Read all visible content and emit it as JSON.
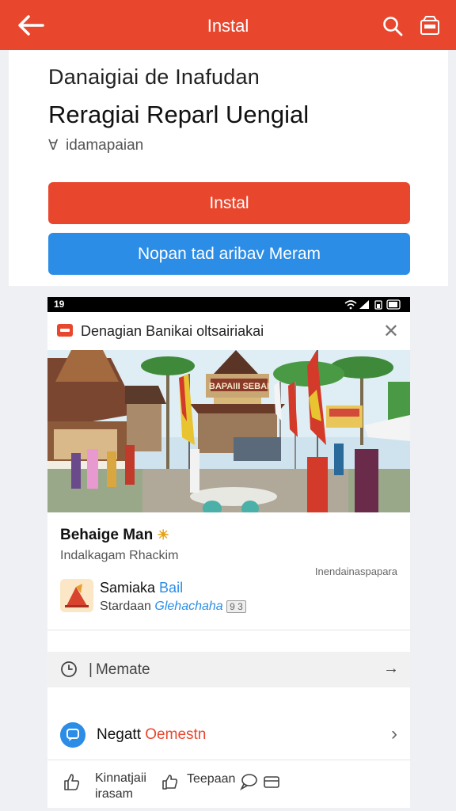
{
  "topbar": {
    "title": "Instal",
    "colors": {
      "background": "#e8472e"
    }
  },
  "header": {
    "app_subtitle": "Danaigiai de Inafudan",
    "app_name": "Reragiai Reparl Uengial",
    "developer": "idamapaian",
    "install_label": "Instal",
    "open_label": "Nopan tad aribav Meram"
  },
  "phone": {
    "status_time": "19",
    "notification": {
      "title": "Denagian Banikai oltsairiakai"
    },
    "post": {
      "title": "Behaige Man",
      "subtitle": "Indalkagam Rhackim",
      "meta": "Inendainaspapara"
    },
    "app_row": {
      "name": "Samiaka",
      "name_accent": "Bail",
      "sub": "Stardaan",
      "sub_link": "Glehachaha",
      "badge": "9 3"
    },
    "more_label": "Memate",
    "nav": {
      "label": "Negatt",
      "label_accent": "Oemestn"
    },
    "actions": {
      "like_line1": "Kinnatjaii",
      "like_line2": "irasam",
      "share_label": "Teepaan"
    }
  },
  "colors": {
    "accent": "#e8472e",
    "link": "#2b8de6"
  }
}
